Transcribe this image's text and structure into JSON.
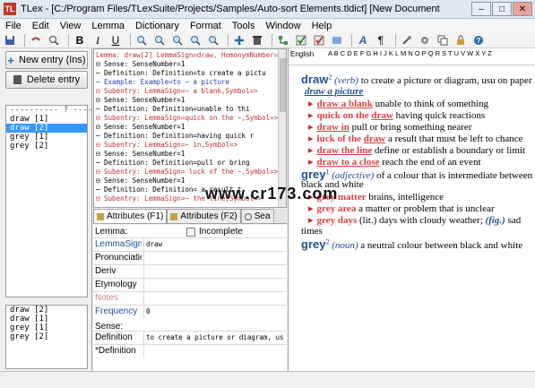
{
  "window": {
    "app_icon": "TL",
    "title": "TLex - [C:/Program Files/TLexSuite/Projects/Samples/Auto-sort Elements.tldict] [New Document Object Model]",
    "minimize": "–",
    "maximize": "□",
    "close": "✕"
  },
  "menu": [
    "File",
    "Edit",
    "View",
    "Lemma",
    "Dictionary",
    "Format",
    "Tools",
    "Window",
    "Help"
  ],
  "toolbar": {
    "icons": [
      "save-icon",
      "undo-icon",
      "find-icon",
      "bold-icon",
      "italic-icon",
      "underline-icon",
      "zoom-in-icon",
      "zoom-out-icon",
      "insert-icon",
      "add-icon",
      "delete-icon",
      "tree-icon",
      "check-icon",
      "font-icon",
      "paragraph-icon",
      "tools-icon",
      "help-icon"
    ],
    "bold": "B",
    "italic": "I",
    "underline": "U"
  },
  "left": {
    "new_entry": "New entry (Ins)",
    "delete_entry": "Delete entry",
    "separator_line": "---------- ? ----------",
    "entries_top": [
      "draw [1]",
      "draw [2]",
      "grey [1]",
      "grey [2]"
    ],
    "selected_index": 1,
    "entries_bottom": [
      "draw [2]",
      "draw [1]",
      "grey [1]",
      "grey [2]"
    ]
  },
  "tree": [
    {
      "text": "Lemma: draw[2]  LemmaSign=draw, HomonymNumber=2, ...",
      "color": "red"
    },
    {
      "text": "  ⊟ Sense:  SenseNumber=1",
      "color": "black"
    },
    {
      "text": "      ─ Definition:  Definition=to create a pictu",
      "color": "black"
    },
    {
      "text": "      ─ Example:  Example=to ~ a picture",
      "color": "blue"
    },
    {
      "text": "⊟ Subentry:  LemmaSign=~ a blank,Symbol=>",
      "color": "red"
    },
    {
      "text": "  ⊟ Sense:  SenseNumber=1",
      "color": "black"
    },
    {
      "text": "      ─ Definition:  Definition=unable to thi",
      "color": "black"
    },
    {
      "text": "⊟ Subentry:  LemmaSign=quick on the ~,Symbol=>",
      "color": "red"
    },
    {
      "text": "  ⊟ Sense:  SenseNumber=1",
      "color": "black"
    },
    {
      "text": "      ─ Definition:  Definition=having quick r",
      "color": "black"
    },
    {
      "text": "⊟ Subentry:  LemmaSign=~ in,Symbol=>",
      "color": "red"
    },
    {
      "text": "  ⊟ Sense:  SenseNumber=1",
      "color": "black"
    },
    {
      "text": "      ─ Definition:  Definition=pull or bring",
      "color": "black"
    },
    {
      "text": "⊟ Subentry:  LemmaSign= luck of the ~,Symbol=>",
      "color": "red"
    },
    {
      "text": "  ⊟ Sense:  SenseNumber=1",
      "color": "black"
    },
    {
      "text": "      ─ Definition:  Definition= a result t",
      "color": "black"
    },
    {
      "text": "⊟ Subentry:  LemmaSign=~ the line,Symbol=>",
      "color": "red"
    }
  ],
  "tabs": [
    "Attributes (F1)",
    "Attributes (F2)",
    "Sea"
  ],
  "props": {
    "lemma_label": "Lemma:",
    "incomplete_label": "Incomplete",
    "rows": [
      {
        "name": "LemmaSign",
        "value": "draw",
        "link": true
      },
      {
        "name": "Pronunciation",
        "value": ""
      },
      {
        "name": "Deriv",
        "value": ""
      },
      {
        "name": "Etymology",
        "value": ""
      },
      {
        "name": "Notes",
        "value": "",
        "muted": true
      },
      {
        "name": "Frequency",
        "value": "0",
        "link": true
      }
    ],
    "sense_label": "Sense:",
    "sense_rows": [
      {
        "name": "Definition",
        "value": "to create a picture or diagram, usu"
      },
      {
        "name": "*Definition",
        "value": ""
      }
    ]
  },
  "preview": {
    "lang": "English",
    "alphabet": "A B C D E F G H I J K L M N O P Q R S T U V W X Y Z",
    "draw2": {
      "headword": "draw",
      "sup": "2",
      "pos": "(verb)",
      "definition": "to create a picture or diagram, usu on paper :",
      "example_cont": "to",
      "example": "draw a picture",
      "subs": [
        {
          "pre": "",
          "term": "draw a blank",
          "post": "unable to think of something"
        },
        {
          "pre": "quick on the ",
          "term": "draw",
          "post": "having quick reactions"
        },
        {
          "pre": "",
          "term": "draw in",
          "post": "pull or bring something nearer"
        },
        {
          "pre": "luck of the ",
          "term": "draw",
          "post": "a result that must be left to chance"
        },
        {
          "pre": "",
          "term": "draw the line",
          "post": "define or establish a boundary or limit"
        },
        {
          "pre": "",
          "term": "draw to a close",
          "post": "reach the end of an event"
        }
      ]
    },
    "grey1": {
      "headword": "grey",
      "sup": "1",
      "pos": "(adjective)",
      "definition": "of a colour that is intermediate between",
      "definition2": "black and white",
      "subs": [
        {
          "term": "grey matter",
          "post": "brains, intelligence"
        },
        {
          "term": "grey area",
          "post": "a matter or problem that is unclear"
        },
        {
          "term": "grey days",
          "post": "(lit.) days with cloudy weather;",
          "fig": "(fig.)",
          "post2": "sad"
        }
      ],
      "times": "times"
    },
    "grey2": {
      "headword": "grey",
      "sup": "2",
      "pos": "(noun)",
      "definition": "a neutral colour between black and white"
    }
  },
  "watermark": "www.cr173.com"
}
